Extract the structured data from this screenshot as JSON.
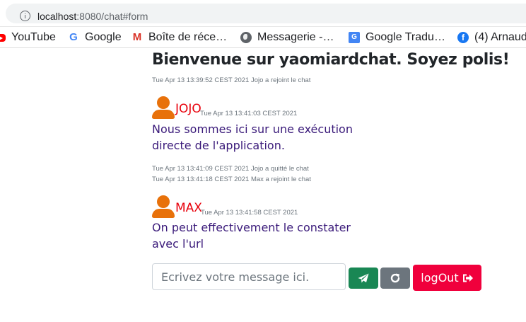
{
  "browser": {
    "url_host": "localhost",
    "url_path": ":8080/chat#form"
  },
  "bookmarks": [
    {
      "label": "YouTube",
      "icon": "youtube-icon"
    },
    {
      "label": "Google",
      "icon": "google-icon"
    },
    {
      "label": "Boîte de réce…",
      "icon": "gmail-icon"
    },
    {
      "label": "Messagerie -…",
      "icon": "globe-icon"
    },
    {
      "label": "Google Tradu…",
      "icon": "google-translate-icon"
    },
    {
      "label": "(4) Arnaud",
      "icon": "facebook-icon"
    }
  ],
  "page": {
    "title": "Bienvenue sur yaomiardchat. Soyez polis!"
  },
  "messages": {
    "sys1": "Tue Apr 13 13:39:52 CEST 2021 Jojo a rejoint le chat",
    "jojo": {
      "name": "JOJO",
      "time": "Tue Apr 13 13:41:03 CEST 2021",
      "text": "Nous sommes ici sur une exécution directe de l'application."
    },
    "sys2": "Tue Apr 13 13:41:09 CEST 2021 Jojo a quitté le chat",
    "sys3": "Tue Apr 13 13:41:18 CEST 2021 Max a rejoint le chat",
    "max": {
      "name": "MAX",
      "time": "Tue Apr 13 13:41:58 CEST 2021",
      "text": "On peut effectivement le constater avec l'url"
    }
  },
  "form": {
    "placeholder": "Ecrivez votre message ici.",
    "value": "",
    "logout_label": "logOut"
  },
  "colors": {
    "username": "#e8000b",
    "message_text": "#3a1a7a",
    "avatar": "#e8710a",
    "send_button": "#198754",
    "refresh_button": "#6c757d",
    "logout_button": "#f0003c"
  }
}
